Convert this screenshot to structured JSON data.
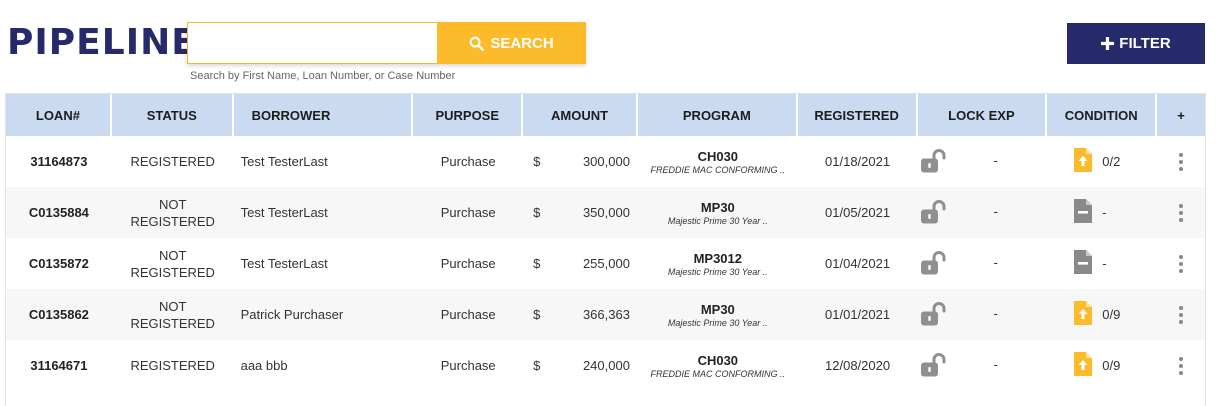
{
  "header": {
    "title": "PIPELINE",
    "search": {
      "value": "",
      "placeholder": "",
      "button_label": "SEARCH",
      "hint": "Search by First Name, Loan Number, or Case Number"
    },
    "filter_label": "FILTER"
  },
  "colors": {
    "title": "#262a6b",
    "search_button": "#fbbb2b",
    "filter_button": "#262a6b",
    "table_header": "#c9daf1",
    "doc_upload_icon": "#fbbb2b",
    "doc_icon_gray": "#8a8a8a"
  },
  "table": {
    "columns": [
      "LOAN#",
      "STATUS",
      "BORROWER",
      "PURPOSE",
      "AMOUNT",
      "PROGRAM",
      "REGISTERED",
      "LOCK EXP",
      "CONDITION",
      "+"
    ],
    "rows": [
      {
        "loan": "31164873",
        "status_line1": "REGISTERED",
        "status_line2": "",
        "borrower": "Test TesterLast",
        "purpose": "Purchase",
        "currency": "$",
        "amount": "300,000",
        "program_code": "CH030",
        "program_desc": "FREDDIE MAC CONFORMING ..",
        "registered": "01/18/2021",
        "lock_exp": "-",
        "condition_icon": "upload-doc-icon",
        "condition": "0/2"
      },
      {
        "loan": "C0135884",
        "status_line1": "NOT",
        "status_line2": "REGISTERED",
        "borrower": "Test TesterLast",
        "purpose": "Purchase",
        "currency": "$",
        "amount": "350,000",
        "program_code": "MP30",
        "program_desc": "Majestic Prime 30 Year ..",
        "registered": "01/05/2021",
        "lock_exp": "-",
        "condition_icon": "doc-icon",
        "condition": "-"
      },
      {
        "loan": "C0135872",
        "status_line1": "NOT",
        "status_line2": "REGISTERED",
        "borrower": "Test TesterLast",
        "purpose": "Purchase",
        "currency": "$",
        "amount": "255,000",
        "program_code": "MP3012",
        "program_desc": "Majestic Prime 30 Year ..",
        "registered": "01/04/2021",
        "lock_exp": "-",
        "condition_icon": "doc-icon",
        "condition": "-"
      },
      {
        "loan": "C0135862",
        "status_line1": "NOT",
        "status_line2": "REGISTERED",
        "borrower": "Patrick Purchaser",
        "purpose": "Purchase",
        "currency": "$",
        "amount": "366,363",
        "program_code": "MP30",
        "program_desc": "Majestic Prime 30 Year ..",
        "registered": "01/01/2021",
        "lock_exp": "-",
        "condition_icon": "upload-doc-icon",
        "condition": "0/9"
      },
      {
        "loan": "31164671",
        "status_line1": "REGISTERED",
        "status_line2": "",
        "borrower": "aaa bbb",
        "purpose": "Purchase",
        "currency": "$",
        "amount": "240,000",
        "program_code": "CH030",
        "program_desc": "FREDDIE MAC CONFORMING ..",
        "registered": "12/08/2020",
        "lock_exp": "-",
        "condition_icon": "upload-doc-icon",
        "condition": "0/9"
      }
    ]
  }
}
